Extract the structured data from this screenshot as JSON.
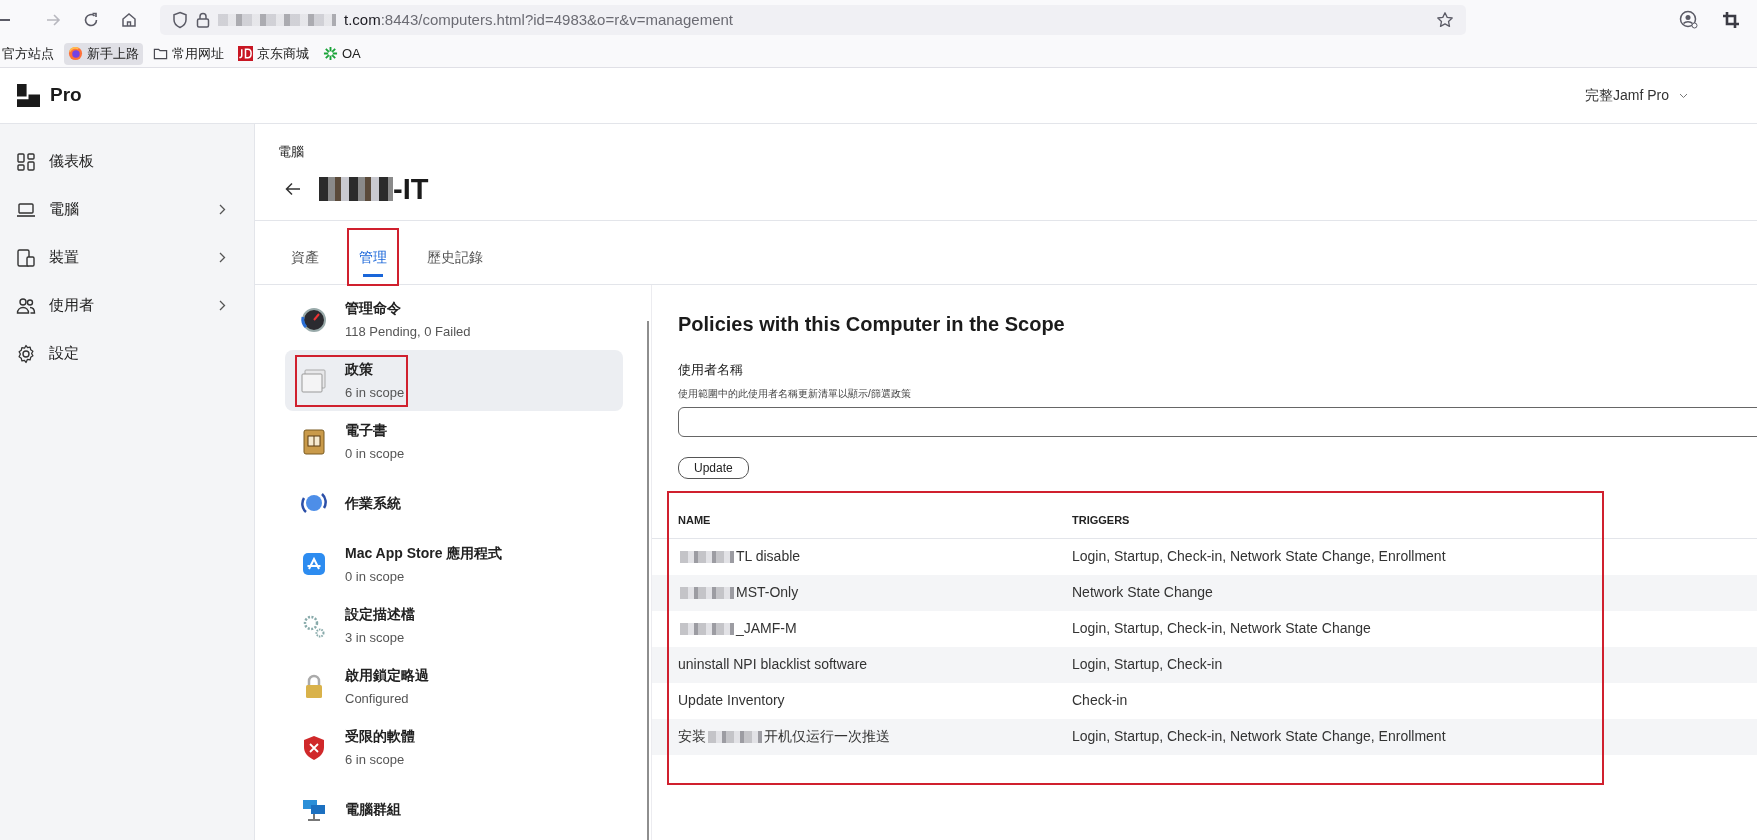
{
  "browser": {
    "forward_disabled": true,
    "url": {
      "host": "t.com",
      "path": ":8443/computers.html?id=4983&o=r&v=management"
    },
    "bookmarks": [
      {
        "kind": "plain",
        "label": "官方站点",
        "selected": false
      },
      {
        "kind": "firefox",
        "label": "新手上路",
        "selected": true
      },
      {
        "kind": "folder",
        "label": "常用网址",
        "selected": false
      },
      {
        "kind": "jd",
        "label": "京东商城",
        "selected": false
      },
      {
        "kind": "oa",
        "label": "OA",
        "selected": false
      }
    ]
  },
  "app_header": {
    "logo_text": "Pro",
    "account": "完整Jamf Pro"
  },
  "sidebar": {
    "items": [
      {
        "kind": "dashboard",
        "label": "儀表板",
        "has_children": false
      },
      {
        "kind": "laptop",
        "label": "電腦",
        "has_children": true
      },
      {
        "kind": "devices",
        "label": "裝置",
        "has_children": true
      },
      {
        "kind": "users",
        "label": "使用者",
        "has_children": true
      },
      {
        "kind": "settings",
        "label": "設定",
        "has_children": false
      }
    ]
  },
  "breadcrumb": "電腦",
  "title": {
    "redacted_prefix": true,
    "text": "-IT"
  },
  "tabs": [
    {
      "label": "資產",
      "selected": false,
      "annotated": false
    },
    {
      "label": "管理",
      "selected": true,
      "annotated": true
    },
    {
      "label": "歷史記錄",
      "selected": false,
      "annotated": false
    }
  ],
  "management_items": [
    {
      "kind": "commands",
      "title": "管理命令",
      "subtitle": "118 Pending, 0 Failed",
      "selected": false,
      "annotated": false
    },
    {
      "kind": "policies",
      "title": "政策",
      "subtitle": "6 in scope",
      "selected": true,
      "annotated": true
    },
    {
      "kind": "ebooks",
      "title": "電子書",
      "subtitle": "0 in scope",
      "selected": false,
      "annotated": false
    },
    {
      "kind": "os",
      "title": "作業系統",
      "selected": false,
      "annotated": false
    },
    {
      "kind": "appstore",
      "title": "Mac App Store 應用程式",
      "subtitle": "0 in scope",
      "selected": false,
      "annotated": false
    },
    {
      "kind": "profiles",
      "title": "設定描述檔",
      "subtitle": "3 in scope",
      "selected": false,
      "annotated": false
    },
    {
      "kind": "lock",
      "title": "啟用鎖定略過",
      "subtitle": "Configured",
      "selected": false,
      "annotated": false
    },
    {
      "kind": "restricted",
      "title": "受限的軟體",
      "subtitle": "6 in scope",
      "selected": false,
      "annotated": false
    },
    {
      "kind": "groups",
      "title": "電腦群組",
      "selected": false,
      "annotated": false
    }
  ],
  "panel": {
    "heading": "Policies with this Computer in the Scope",
    "field_label": "使用者名稱",
    "field_hint": "使用範圍中的此使用者名稱更新清單以顯示/篩選政策",
    "button": "Update"
  },
  "table": {
    "annotated": true,
    "columns": [
      "NAME",
      "TRIGGERS"
    ],
    "rows": [
      {
        "name_parts": [
          {
            "kind": "redacted"
          },
          {
            "kind": "text",
            "text": "TL disable"
          }
        ],
        "triggers": "Login, Startup, Check-in, Network State Change, Enrollment"
      },
      {
        "name_parts": [
          {
            "kind": "redacted"
          },
          {
            "kind": "text",
            "text": "MST-Only"
          }
        ],
        "triggers": "Network State Change"
      },
      {
        "name_parts": [
          {
            "kind": "redacted"
          },
          {
            "kind": "text",
            "text": "_JAMF-M"
          }
        ],
        "triggers": "Login, Startup, Check-in, Network State Change"
      },
      {
        "name_parts": [
          {
            "kind": "text",
            "text": "uninstall NPI blacklist software"
          }
        ],
        "triggers": "Login, Startup, Check-in"
      },
      {
        "name_parts": [
          {
            "kind": "text",
            "text": "Update Inventory"
          }
        ],
        "triggers": "Check-in"
      },
      {
        "name_parts": [
          {
            "kind": "text",
            "text": "安装"
          },
          {
            "kind": "redacted"
          },
          {
            "kind": "text",
            "text": "开机仅运行一次推送"
          }
        ],
        "triggers": "Login, Startup, Check-in, Network State Change, Enrollment"
      }
    ]
  }
}
